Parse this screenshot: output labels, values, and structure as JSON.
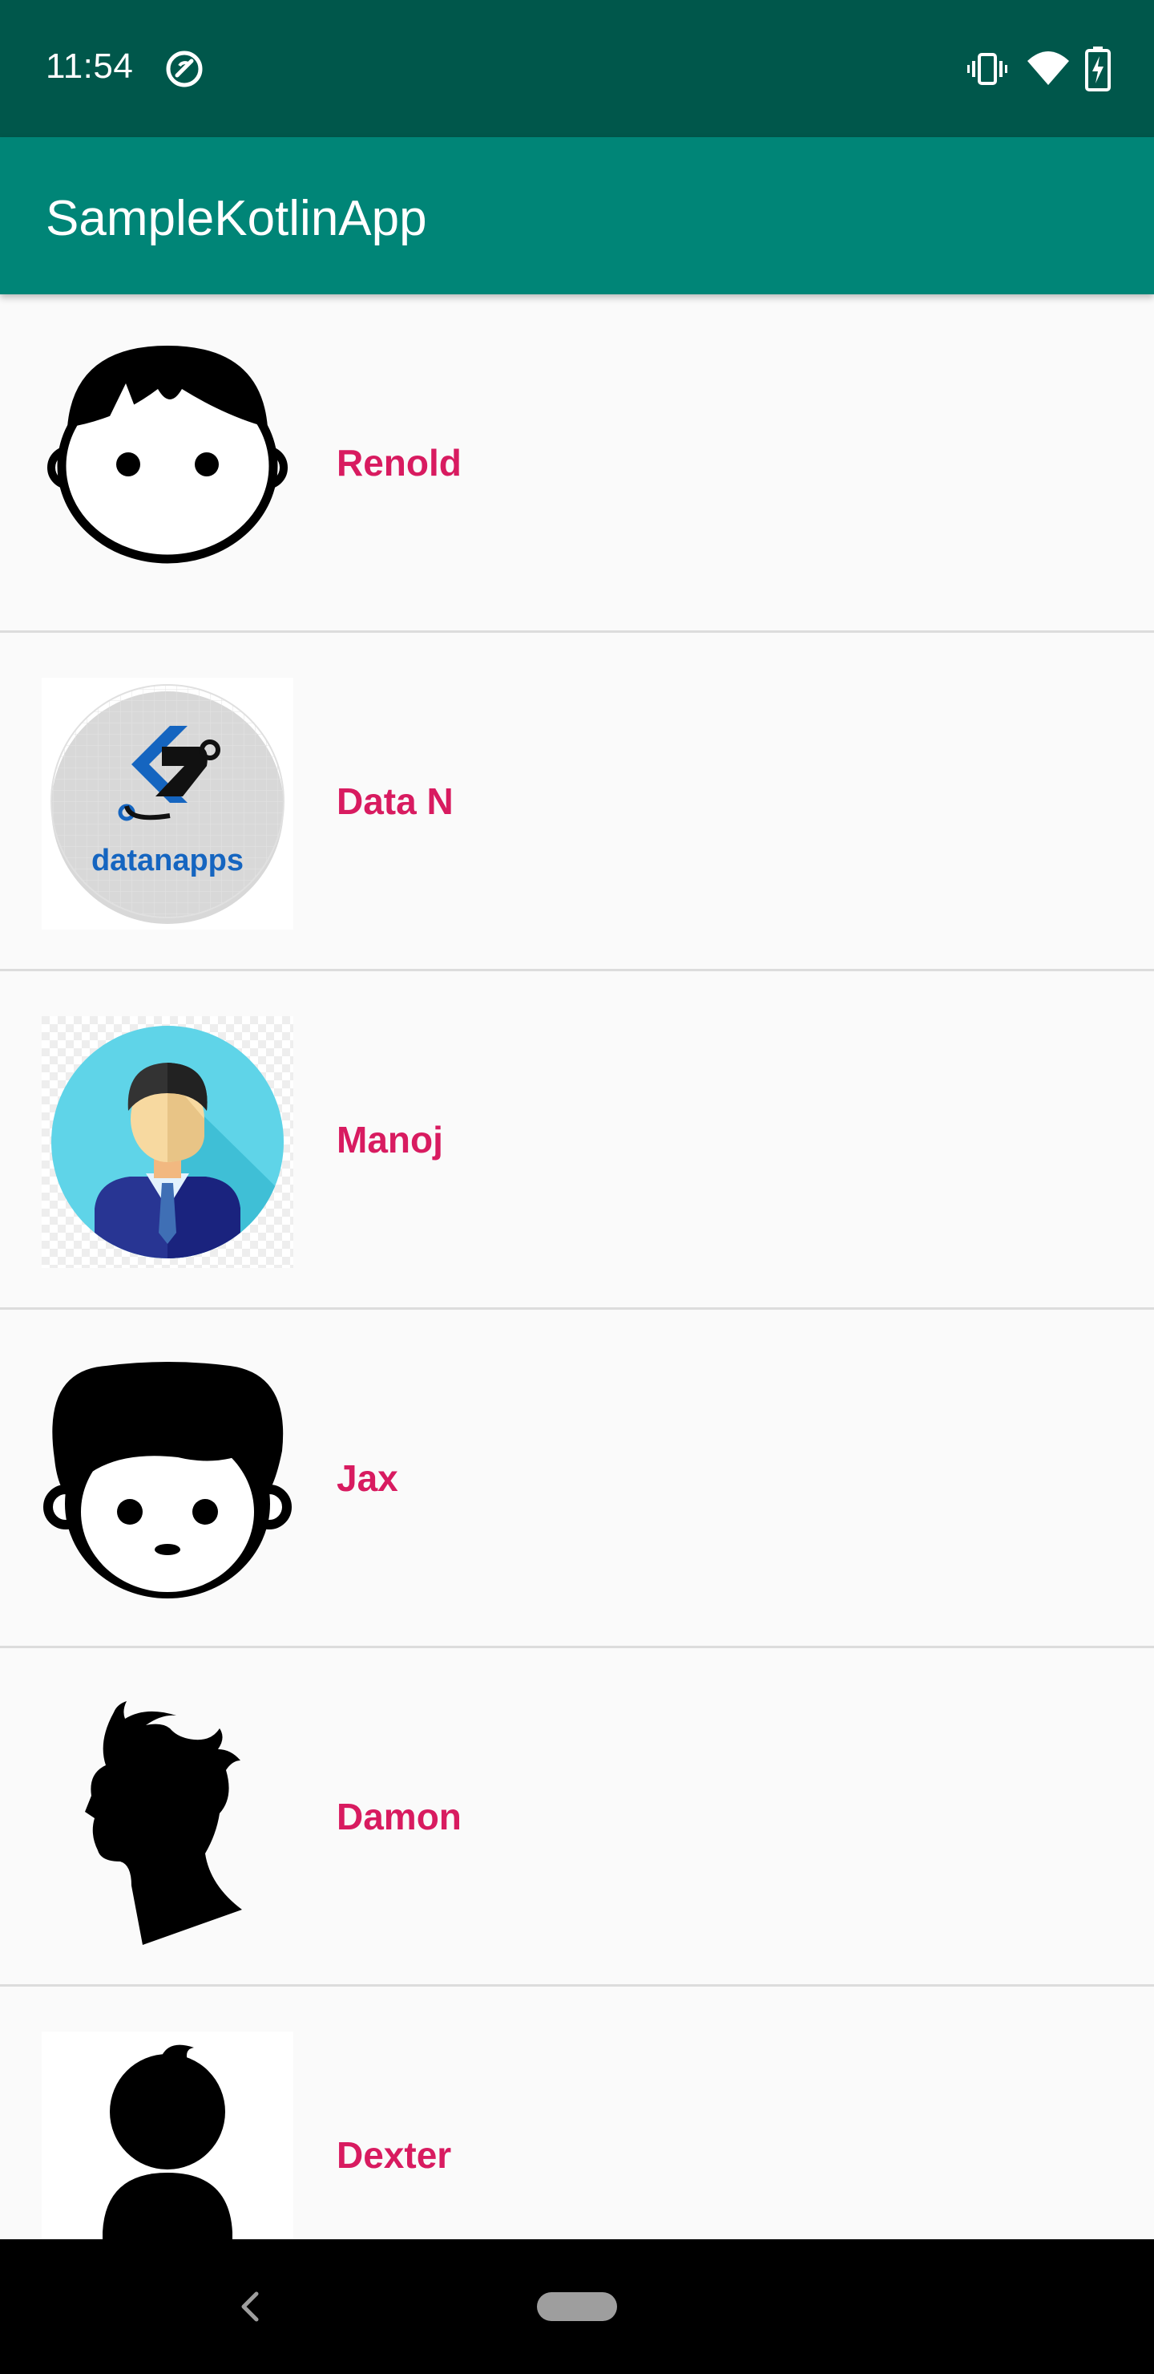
{
  "status_bar": {
    "time": "11:54",
    "icons": [
      "sync-icon",
      "vibrate-icon",
      "wifi-icon",
      "battery-charging-icon"
    ]
  },
  "app_bar": {
    "title": "SampleKotlinApp"
  },
  "contacts": [
    {
      "name": "Renold",
      "avatar": "boy-face-outline-icon"
    },
    {
      "name": "Data N",
      "avatar": "datanapps-logo"
    },
    {
      "name": "Manoj",
      "avatar": "businessman-avatar"
    },
    {
      "name": "Jax",
      "avatar": "boy-face-filled-hair-icon"
    },
    {
      "name": "Damon",
      "avatar": "man-profile-silhouette"
    },
    {
      "name": "Dexter",
      "avatar": "person-silhouette"
    }
  ],
  "colors": {
    "status_bar": "#00574b",
    "app_bar": "#008577",
    "name_text": "#d81b60",
    "list_background": "#fafafa"
  },
  "navigation": {
    "buttons": [
      "back-icon",
      "home-pill"
    ]
  }
}
